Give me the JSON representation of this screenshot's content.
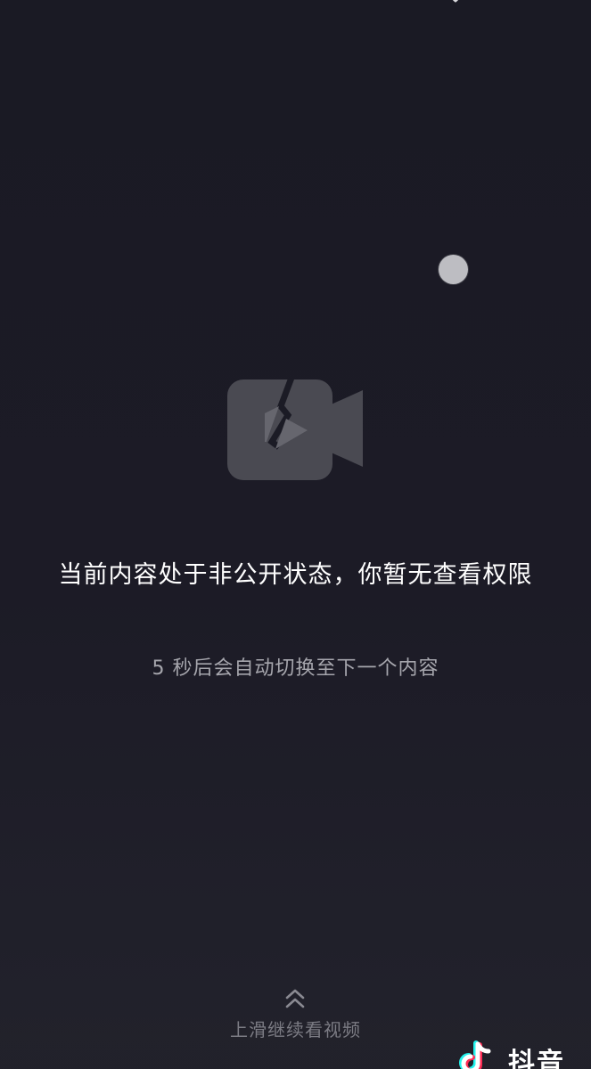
{
  "colors": {
    "background": "#1c1b26",
    "message_text": "#ffffff",
    "countdown_text": "#a6a6ad",
    "hint_text": "#7c7c84",
    "icon_fill": "#4a4a52",
    "touch_dot": "#bdbdc2"
  },
  "icons": {
    "top_glyph": "chevron-icon",
    "placeholder": "video-unavailable-icon",
    "swipe": "double-chevron-up-icon",
    "brand": "douyin-logo-icon"
  },
  "player": {
    "message": "当前内容处于非公开状态，你暂无查看权限",
    "countdown": "5 秒后会自动切换至下一个内容"
  },
  "footer": {
    "swipe_hint": "上滑继续看视频"
  },
  "brand": {
    "name": "抖音"
  }
}
